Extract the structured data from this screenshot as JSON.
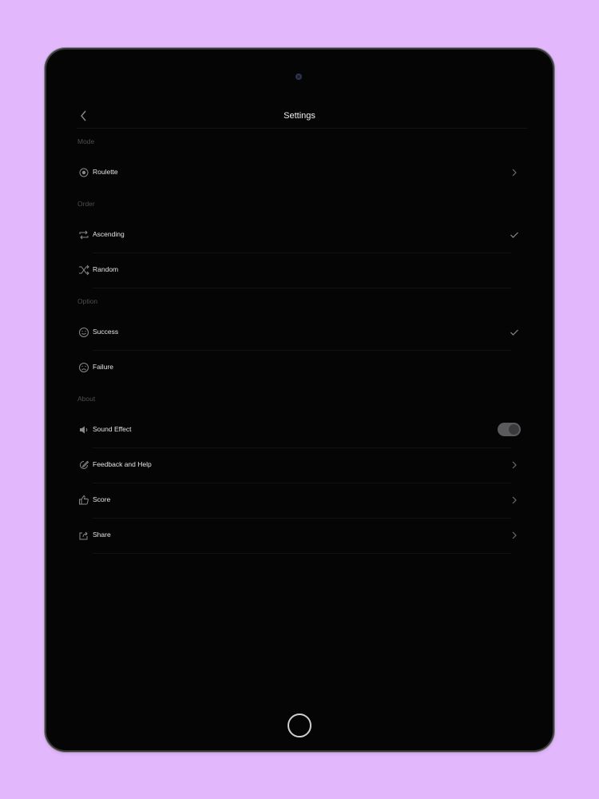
{
  "header": {
    "title": "Settings"
  },
  "sections": {
    "mode": {
      "header": "Mode",
      "items": [
        {
          "label": "Roulette",
          "icon": "target-icon",
          "accessory": "chevron"
        }
      ]
    },
    "order": {
      "header": "Order",
      "items": [
        {
          "label": "Ascending",
          "icon": "loop-icon",
          "selected": true
        },
        {
          "label": "Random",
          "icon": "shuffle-icon",
          "selected": false
        }
      ]
    },
    "option": {
      "header": "Option",
      "items": [
        {
          "label": "Success",
          "icon": "smile-icon",
          "selected": true
        },
        {
          "label": "Failure",
          "icon": "frown-icon",
          "selected": false
        }
      ]
    },
    "about": {
      "header": "About",
      "items": [
        {
          "label": "Sound Effect",
          "icon": "speaker-icon",
          "toggle": true
        },
        {
          "label": "Feedback and Help",
          "icon": "pencil-icon",
          "accessory": "chevron"
        },
        {
          "label": "Score",
          "icon": "thumbs-up-icon",
          "accessory": "chevron"
        },
        {
          "label": "Share",
          "icon": "share-icon",
          "accessory": "chevron"
        }
      ]
    }
  },
  "colors": {
    "background": "#e2b7fb",
    "screen": "#050505",
    "text": "#e4e4e5",
    "section_header": "#4e4e50",
    "toggle_track": "#5b5b5d"
  }
}
